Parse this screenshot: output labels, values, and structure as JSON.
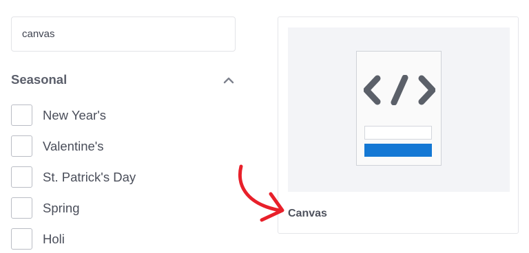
{
  "search": {
    "value": "canvas"
  },
  "section": {
    "title": "Seasonal",
    "collapse_icon": "chevron-up-icon"
  },
  "filters": [
    {
      "label": "New Year's",
      "checked": false
    },
    {
      "label": "Valentine's",
      "checked": false
    },
    {
      "label": "St. Patrick's Day",
      "checked": false
    },
    {
      "label": "Spring",
      "checked": false
    },
    {
      "label": "Holi",
      "checked": false
    }
  ],
  "card": {
    "title": "Canvas",
    "preview_icon": "code-icon"
  },
  "colors": {
    "accent_blue": "#1478d4",
    "annotation_red": "#e8202a",
    "text_gray": "#4a4e5a",
    "preview_bg": "#f3f4f7"
  }
}
